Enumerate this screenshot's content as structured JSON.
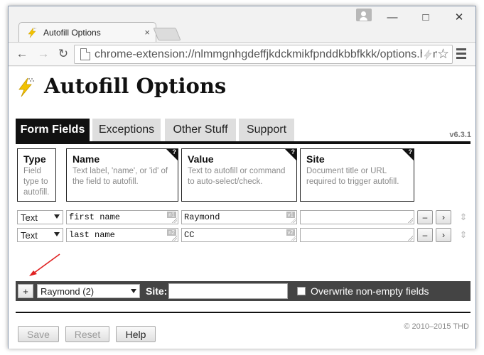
{
  "browser": {
    "tab_title": "Autofill Options",
    "tab_close": "×",
    "url": "chrome-extension://nlmmgnhgdeffjkdckmikfpnddkbbfkkk/options.html",
    "window_controls": {
      "minimize": "—",
      "maximize": "□",
      "close": "✕"
    },
    "nav": {
      "back": "←",
      "forward": "→",
      "reload": "↻",
      "star": "☆"
    }
  },
  "page": {
    "title": "Autofill Options",
    "version": "v6.3.1",
    "tabs": [
      {
        "label": "Form Fields",
        "active": true
      },
      {
        "label": "Exceptions",
        "active": false
      },
      {
        "label": "Other Stuff",
        "active": false
      },
      {
        "label": "Support",
        "active": false
      }
    ],
    "headers": [
      {
        "title": "Type",
        "desc": "Field type to autofill."
      },
      {
        "title": "Name",
        "desc": "Text label, 'name', or 'id' of the field to autofill."
      },
      {
        "title": "Value",
        "desc": "Text to autofill or command to auto-select/check."
      },
      {
        "title": "Site",
        "desc": "Document title or URL required to trigger autofill."
      }
    ],
    "help_mark": "?",
    "rows": [
      {
        "type": "Text",
        "name": "first name",
        "name_badge": "n1",
        "value": "Raymond",
        "value_badge": "v1",
        "site": ""
      },
      {
        "type": "Text",
        "name": "last name",
        "name_badge": "n2",
        "value": "CC",
        "value_badge": "v2",
        "site": ""
      }
    ],
    "row_buttons": {
      "remove": "–",
      "more": "›",
      "move": "⇕"
    },
    "bar": {
      "add": "+",
      "profile": "Raymond (2)",
      "site_label": "Site:",
      "site_value": "",
      "overwrite_label": "Overwrite non-empty fields",
      "overwrite_checked": false
    },
    "copyright": "© 2010–2015 THD",
    "footer_buttons": {
      "save": "Save",
      "reset": "Reset",
      "help": "Help"
    },
    "colors": {
      "accent": "#111111",
      "bar": "#444444",
      "logo": "#f2c200",
      "annotation_arrow": "#e02020"
    }
  }
}
